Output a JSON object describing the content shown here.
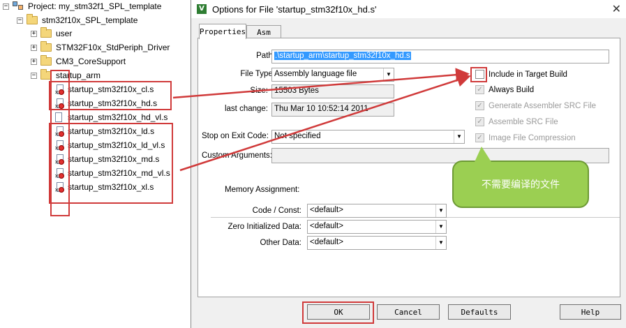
{
  "tree": {
    "project_label": "Project: my_stm32f1_SPL_template",
    "target_label": "stm32f10x_SPL_template",
    "groups": [
      "user",
      "STM32F10x_StdPeriph_Driver",
      "CM3_CoreSupport",
      "startup_arm"
    ],
    "files": [
      "startup_stm32f10x_cl.s",
      "startup_stm32f10x_hd.s",
      "startup_stm32f10x_hd_vl.s",
      "startup_stm32f10x_ld.s",
      "startup_stm32f10x_ld_vl.s",
      "startup_stm32f10x_md.s",
      "startup_stm32f10x_md_vl.s",
      "startup_stm32f10x_xl.s"
    ]
  },
  "dialog": {
    "title": "Options for File 'startup_stm32f10x_hd.s'",
    "tabs": [
      "Properties",
      "Asm"
    ],
    "path_label": "Path:",
    "path_value": ".\\startup_arm\\startup_stm32f10x_hd.s",
    "file_type_label": "File Type:",
    "file_type_value": "Assembly language file",
    "size_label": "Size:",
    "size_value": "15503 Bytes",
    "last_change_label": "last change:",
    "last_change_value": "Thu Mar 10 10:52:14 2011",
    "stop_label": "Stop on Exit Code:",
    "stop_value": "Not specified",
    "custom_args_label": "Custom Arguments:",
    "checks": {
      "include": "Include in Target Build",
      "always": "Always Build",
      "gen_src": "Generate Assembler SRC File",
      "assemble_src": "Assemble SRC File",
      "image_compression": "Image File Compression"
    },
    "memory": {
      "title": "Memory Assignment:",
      "code_label": "Code / Const:",
      "zero_label": "Zero Initialized Data:",
      "other_label": "Other Data:",
      "default_value": "<default>"
    },
    "buttons": {
      "ok": "OK",
      "cancel": "Cancel",
      "defaults": "Defaults",
      "help": "Help"
    }
  },
  "callout": {
    "text": "不需要编译的文件"
  },
  "colors": {
    "annotation_red": "#d03a3a",
    "callout_green": "#9bcf52",
    "selection_blue": "#3399ff"
  }
}
